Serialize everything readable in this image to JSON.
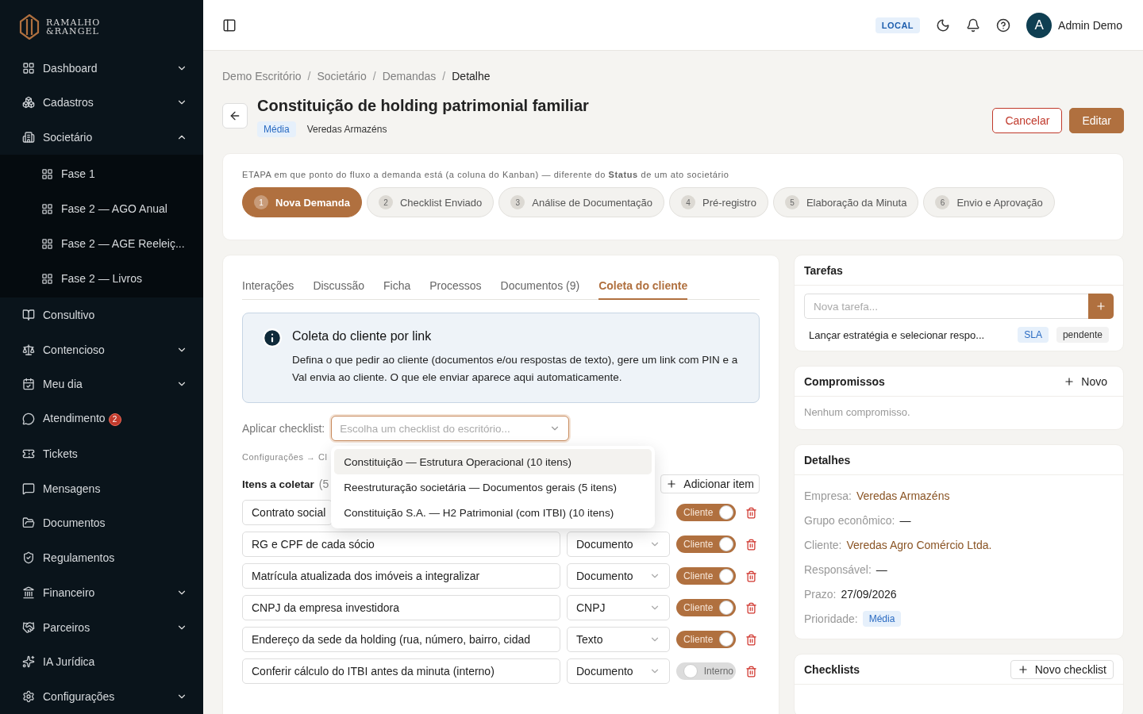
{
  "logo": {
    "line1": "RAMALHO",
    "line2": "&RANGEL"
  },
  "sidebar": {
    "items": [
      {
        "label": "Dashboard",
        "expanded": false
      },
      {
        "label": "Cadastros",
        "expanded": false
      },
      {
        "label": "Societário",
        "expanded": true,
        "children": [
          {
            "label": "Fase 1"
          },
          {
            "label": "Fase 2 — AGO Anual"
          },
          {
            "label": "Fase 2 — AGE Reeleiç..."
          },
          {
            "label": "Fase 2 — Livros"
          }
        ]
      },
      {
        "label": "Consultivo"
      },
      {
        "label": "Contencioso",
        "expanded": false
      },
      {
        "label": "Meu dia",
        "expanded": false
      },
      {
        "label": "Atendimento",
        "badge": "2"
      },
      {
        "label": "Tickets"
      },
      {
        "label": "Mensagens"
      },
      {
        "label": "Documentos"
      },
      {
        "label": "Regulamentos"
      },
      {
        "label": "Financeiro",
        "expanded": false
      },
      {
        "label": "Parceiros",
        "expanded": false
      },
      {
        "label": "IA Jurídica"
      },
      {
        "label": "Configurações",
        "expanded": false
      }
    ]
  },
  "header": {
    "env": "LOCAL",
    "avatar": "A",
    "user": "Admin Demo"
  },
  "breadcrumb": [
    "Demo Escritório",
    "Societário",
    "Demandas",
    "Detalhe"
  ],
  "breadcrumb_separator": "/",
  "title": "Constituição de holding patrimonial familiar",
  "priority_badge": "Média",
  "company_tag": "Veredas Armazéns",
  "actions": {
    "cancel": "Cancelar",
    "edit": "Editar"
  },
  "stage": {
    "hint": "ETAPA  em que ponto do fluxo a demanda está (a coluna do Kanban) — diferente do **Status** de um ato societário",
    "steps": [
      {
        "number": "1",
        "label": "Nova Demanda",
        "selected": true
      },
      {
        "number": "2",
        "label": "Checklist Enviado",
        "selected": false
      },
      {
        "number": "3",
        "label": "Análise de Documentação",
        "selected": false
      },
      {
        "number": "4",
        "label": "Pré-registro",
        "selected": false
      },
      {
        "number": "5",
        "label": "Elaboração da Minuta",
        "selected": false
      },
      {
        "number": "6",
        "label": "Envio e Aprovação",
        "selected": false
      }
    ]
  },
  "tabs": [
    {
      "label": "Interações",
      "selected": false
    },
    {
      "label": "Discussão",
      "selected": false
    },
    {
      "label": "Ficha",
      "selected": false
    },
    {
      "label": "Processos",
      "selected": false
    },
    {
      "label": "Documentos (9)",
      "selected": false
    },
    {
      "label": "Coleta do cliente",
      "selected": true
    }
  ],
  "info": {
    "title": "Coleta do cliente por link",
    "text": "Defina o que pedir ao cliente (documentos e/ou respostas de texto), gere um link com PIN e a Val envia ao cliente. O que ele enviar aparece aqui automaticamente."
  },
  "apply": {
    "label": "Aplicar checklist:",
    "placeholder": "Escolha um checklist do escritório...",
    "hint": "Configurações → Cl",
    "options": [
      {
        "label": "Constituição — Estrutura Operacional (10 itens)",
        "selected": true
      },
      {
        "label": "Reestruturação societária — Documentos gerais (5 itens)",
        "selected": false
      },
      {
        "label": "Constituição S.A. — H2 Patrimonial (com ITBI) (10 itens)",
        "selected": false
      }
    ]
  },
  "items_heading": "Itens a coletar",
  "items_count": "(5",
  "add_item": "Adicionar item",
  "items": [
    {
      "name": "Contrato social",
      "on": true,
      "toggle_label": "Cliente"
    },
    {
      "name": "RG e CPF de cada sócio",
      "type": "Documento",
      "on": true,
      "toggle_label": "Cliente"
    },
    {
      "name": "Matrícula atualizada dos imóveis a integralizar",
      "type": "Documento",
      "on": true,
      "toggle_label": "Cliente"
    },
    {
      "name": "CNPJ da empresa investidora",
      "type": "CNPJ",
      "on": true,
      "toggle_label": "Cliente"
    },
    {
      "name": "Endereço da sede da holding (rua, número, bairro, cidad",
      "type": "Texto",
      "on": true,
      "toggle_label": "Cliente"
    },
    {
      "name": "Conferir cálculo do ITBI antes da minuta (interno)",
      "type": "Documento",
      "on": false,
      "toggle_label": "Interno"
    }
  ],
  "tasks": {
    "title": "Tarefas",
    "placeholder": "Nova tarefa...",
    "rows": [
      {
        "text": "Lançar estratégia e selecionar respo...",
        "tag": "SLA",
        "status": "pendente"
      }
    ]
  },
  "appointments": {
    "title": "Compromissos",
    "new": "Novo",
    "empty": "Nenhum compromisso."
  },
  "details": {
    "title": "Detalhes",
    "rows": [
      {
        "label": "Empresa:",
        "value": "Veredas Armazéns",
        "kind": "link"
      },
      {
        "label": "Grupo econômico:",
        "value": "—",
        "kind": "text"
      },
      {
        "label": "Cliente:",
        "value": "Veredas Agro Comércio Ltda.",
        "kind": "link"
      },
      {
        "label": "Responsável:",
        "value": "—",
        "kind": "text"
      },
      {
        "label": "Prazo:",
        "value": "27/09/2026",
        "kind": "text"
      },
      {
        "label": "Prioridade:",
        "value": "Média",
        "kind": "badge"
      }
    ]
  },
  "checklists": {
    "title": "Checklists",
    "new": "Novo checklist"
  }
}
